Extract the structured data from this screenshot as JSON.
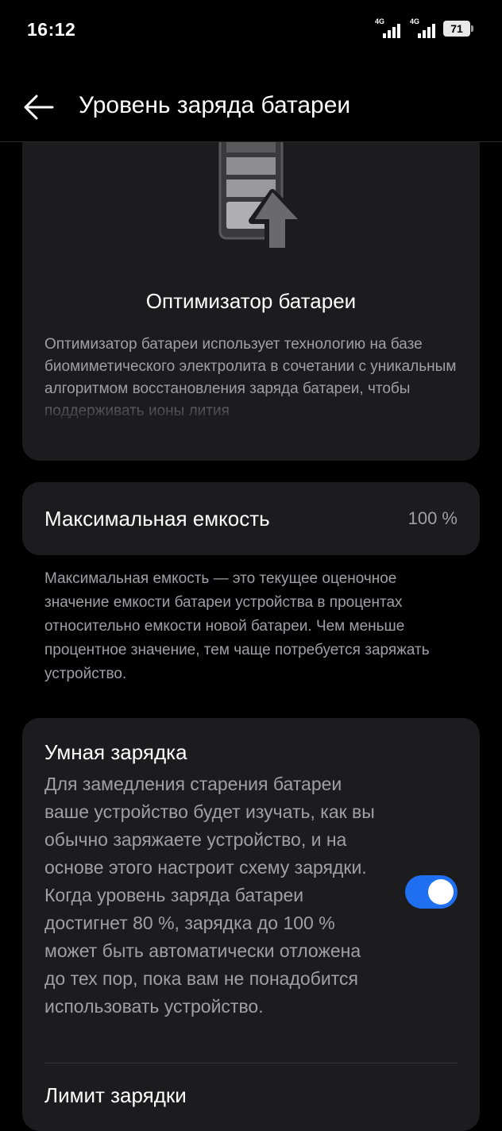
{
  "status_bar": {
    "time": "16:12",
    "signal1_label": "4G",
    "signal2_label": "4G",
    "battery_level": "71"
  },
  "header": {
    "title": "Уровень заряда батареи",
    "back_icon": "arrow-left-icon"
  },
  "optimizer": {
    "icon": "battery-charging-up-icon",
    "title": "Оптимизатор батареи",
    "description": "Оптимизатор батареи использует технологию на базе биомиметического электролита в сочетании с уникальным алгоритмом восстановления заряда батареи, чтобы поддерживать ионы лития"
  },
  "max_capacity": {
    "label": "Максимальная емкость",
    "value": "100 %",
    "note": "Максимальная емкость — это текущее оценочное значение емкости батареи устройства в процентах относительно емкости новой батареи. Чем меньше процентное значение, тем чаще потребуется заряжать устройство."
  },
  "smart_charging": {
    "title": "Умная зарядка",
    "description": "Для замедления старения батареи ваше устройство будет изучать, как вы обычно заряжаете устройство, и на основе этого настроит схему зарядки. Когда уровень заряда батареи достигнет 80 %, зарядка до 100 % может быть автоматически отложена до тех пор, пока вам не понадобится использовать устройство.",
    "enabled": true
  },
  "charge_limit": {
    "title": "Лимит зарядки"
  },
  "colors": {
    "background": "#000000",
    "card": "#1c1c1e",
    "secondary_text": "#a0a0a4",
    "accent": "#1f6ff0"
  }
}
